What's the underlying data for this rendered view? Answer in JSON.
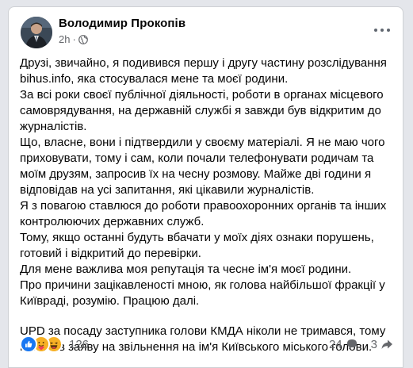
{
  "post": {
    "author": "Володимир Прокопів",
    "time": "2h",
    "separator": "·",
    "paragraphs": [
      "Друзі, звичайно, я подивився першу і другу частину розслідування bihus.info, яка стосувалася мене та моєї родини.",
      "За всі роки своєї публічної діяльності, роботи в органах місцевого самоврядування, на державній службі я завжди був відкритим до журналістів.",
      "Що, власне, вони і підтвердили у своєму матеріалі. Я не маю чого приховувати, тому і сам, коли почали телефонувати родичам та моїм друзям, запросив їх на чесну розмову. Майже дві години я відповідав на усі запитання, які цікавили журналістів.",
      "Я з повагою ставлюся до роботи правоохоронних органів та інших контролюючих державних служб.",
      "Тому, якщо останні будуть вбачати у моїх діях ознаки порушень, готовий і відкритий до перевірки.",
      "Для мене важлива моя репутація та чесне ім'я моєї родини.",
      "Про причини зацікавленості мною, як голова найбільшої фракції у Київраді, розумію. Працюю далі."
    ],
    "update": "UPD за посаду заступника голови КМДА ніколи не тримався, тому написав заяву на звільнення на ім'я Київського міського голови."
  },
  "footer": {
    "reactions_count": "126",
    "comments_count": "24",
    "shares_count": "3",
    "reaction_icons": [
      "like-icon",
      "care-icon",
      "haha-icon"
    ]
  },
  "colors": {
    "like": "#1877f2",
    "care": "#f7b125",
    "haha": "#f7b125",
    "secondary_text": "#65676b",
    "primary_text": "#050505"
  }
}
